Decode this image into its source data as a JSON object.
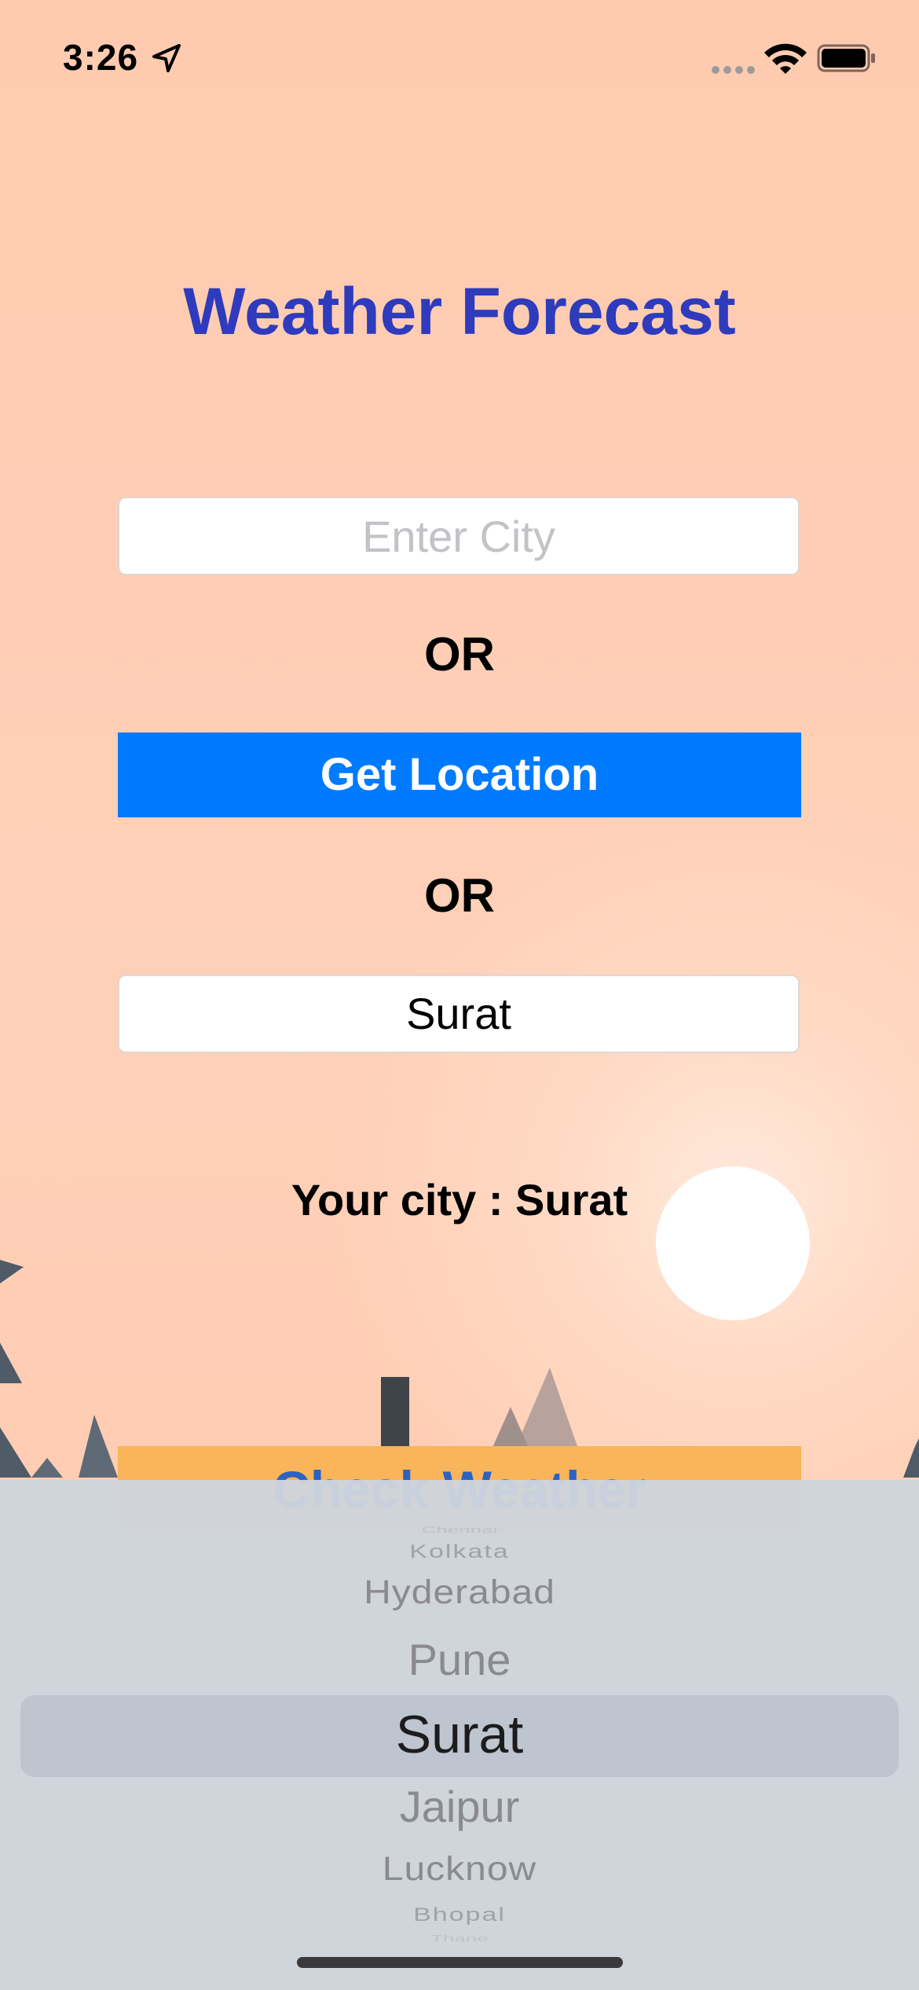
{
  "status_bar": {
    "time": "3:26"
  },
  "app": {
    "title": "Weather Forecast",
    "city_input": {
      "placeholder": "Enter City",
      "value": ""
    },
    "or_label": "OR",
    "get_location_label": "Get Location",
    "selected_city": "Surat",
    "your_city_text": "Your city : Surat",
    "check_weather_label": "Check Weather"
  },
  "picker": {
    "items": [
      "Chennai",
      "Kolkata",
      "Hyderabad",
      "Pune",
      "Surat",
      "Jaipur",
      "Lucknow",
      "Bhopal",
      "Thane"
    ],
    "selected": "Surat"
  },
  "colors": {
    "title": "#2e3bbd",
    "primary_button": "#007aff",
    "secondary_button": "#fab45a",
    "background": "#ffcbb0"
  }
}
